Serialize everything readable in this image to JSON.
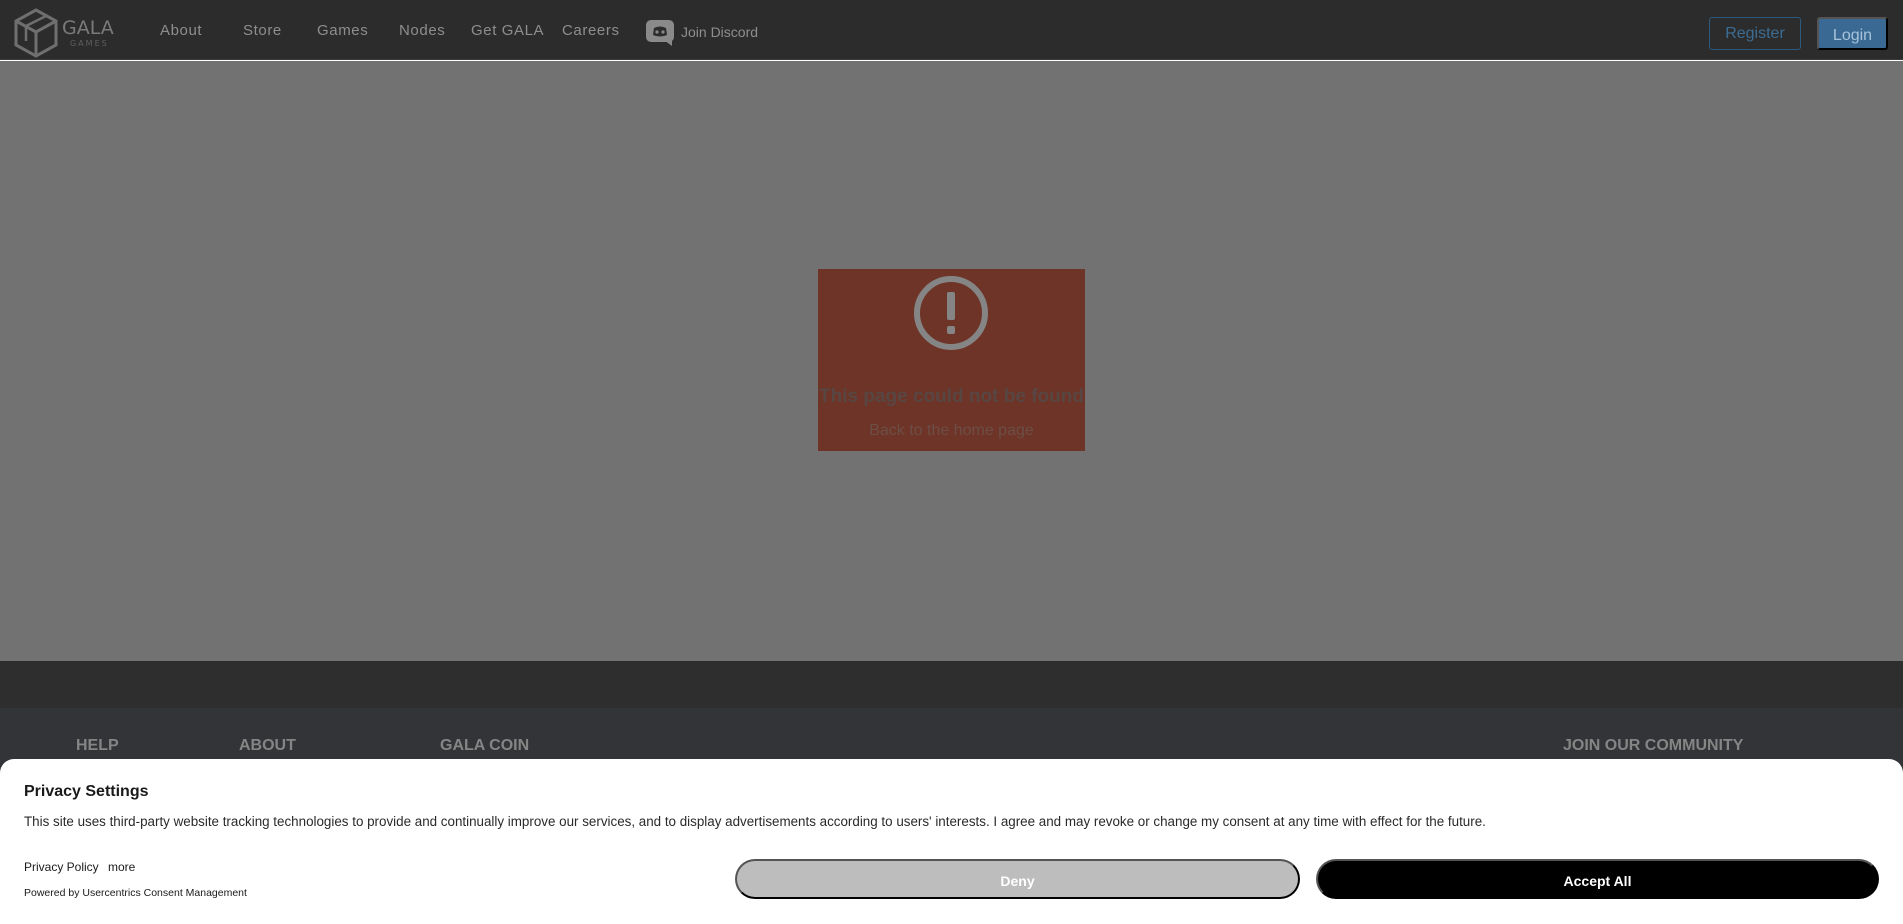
{
  "header": {
    "logo": {
      "word": "GALA",
      "sub": "GAMES"
    },
    "nav": [
      "About",
      "Store",
      "Games",
      "Nodes",
      "Get GALA",
      "Careers"
    ],
    "discord_label": "Join Discord",
    "register_label": "Register",
    "login_label": "Login"
  },
  "error": {
    "title": "This page could not be found",
    "link": "Back to the home page"
  },
  "footer": {
    "headings": [
      "HELP",
      "ABOUT",
      "GALA COIN",
      "JOIN OUR COMMUNITY"
    ]
  },
  "consent": {
    "title": "Privacy Settings",
    "body": "This site uses third-party website tracking technologies to provide and continually improve our services, and to display advertisements according to users' interests. I agree and may revoke or change my consent at any time with effect for the future.",
    "privacy_link": "Privacy Policy",
    "more_link": "more",
    "powered_by": "Powered by Usercentrics Consent Management",
    "deny_label": "Deny",
    "accept_label": "Accept All"
  },
  "colors": {
    "header_bg": "#2c2c2c",
    "overlay_bg": "#727272",
    "error_box": "#6e3427",
    "accept_bg": "#000000",
    "deny_bg": "#bdbdbd",
    "login_bg": "#3a6a94"
  }
}
